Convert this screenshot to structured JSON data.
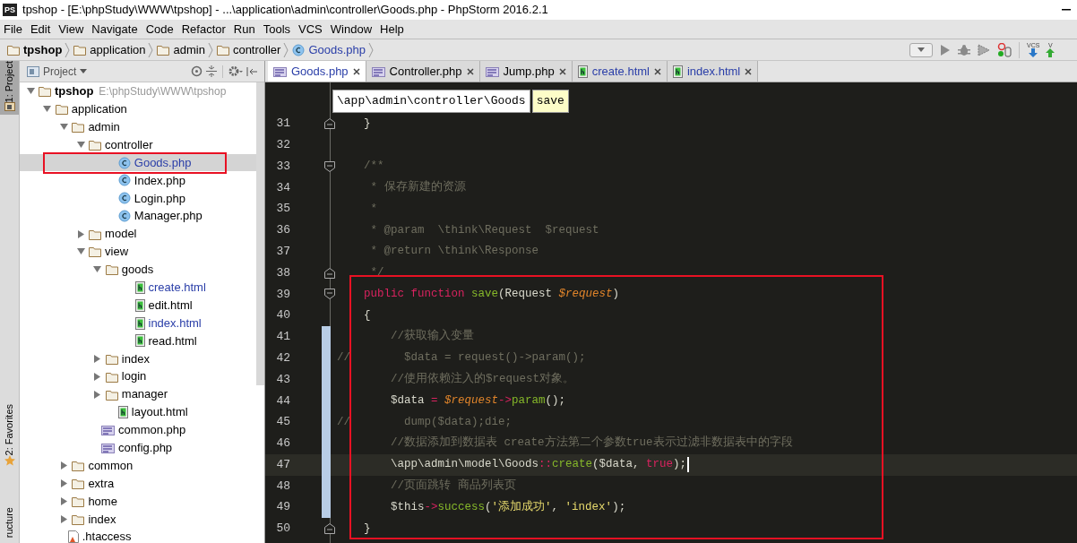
{
  "window": {
    "title": "tpshop - [E:\\phpStudy\\WWW\\tpshop] - ...\\application\\admin\\controller\\Goods.php - PhpStorm 2016.2.1",
    "app_badge": "PS"
  },
  "menu": [
    "File",
    "Edit",
    "View",
    "Navigate",
    "Code",
    "Refactor",
    "Run",
    "Tools",
    "VCS",
    "Window",
    "Help"
  ],
  "breadcrumb": [
    {
      "label": "tpshop",
      "kind": "project"
    },
    {
      "label": "application",
      "kind": "folder"
    },
    {
      "label": "admin",
      "kind": "folder"
    },
    {
      "label": "controller",
      "kind": "folder"
    },
    {
      "label": "Goods.php",
      "kind": "class"
    }
  ],
  "toolbar": {
    "vcs_buttons": [
      "VCS",
      "V"
    ]
  },
  "side_tabs": [
    {
      "label": "1: Project",
      "selected": true,
      "kind": "project"
    },
    {
      "label": "2: Favorites",
      "selected": false,
      "kind": "favorites"
    },
    {
      "label": "ructure",
      "selected": false,
      "kind": "structure"
    }
  ],
  "project_panel": {
    "title": "Project",
    "tree": [
      {
        "label": "tpshop",
        "path": "E:\\phpStudy\\WWW\\tpshop",
        "kind": "folder",
        "expanded": true,
        "selected": false,
        "modified": false,
        "children": [
          {
            "label": "application",
            "kind": "folder",
            "expanded": true,
            "selected": false,
            "modified": false,
            "children": [
              {
                "label": "admin",
                "kind": "folder",
                "expanded": true,
                "selected": false,
                "modified": false,
                "children": [
                  {
                    "label": "controller",
                    "kind": "folder",
                    "expanded": true,
                    "selected": false,
                    "modified": false,
                    "children": [
                      {
                        "label": "Goods.php",
                        "kind": "class",
                        "selected": true,
                        "modified": true
                      },
                      {
                        "label": "Index.php",
                        "kind": "class",
                        "selected": false,
                        "modified": false
                      },
                      {
                        "label": "Login.php",
                        "kind": "class",
                        "selected": false,
                        "modified": false
                      },
                      {
                        "label": "Manager.php",
                        "kind": "class",
                        "selected": false,
                        "modified": false
                      }
                    ]
                  },
                  {
                    "label": "model",
                    "kind": "folder",
                    "expanded": false,
                    "selected": false,
                    "modified": false
                  },
                  {
                    "label": "view",
                    "kind": "folder",
                    "expanded": true,
                    "selected": false,
                    "modified": false,
                    "children": [
                      {
                        "label": "goods",
                        "kind": "folder",
                        "expanded": true,
                        "selected": false,
                        "modified": false,
                        "children": [
                          {
                            "label": "create.html",
                            "kind": "html",
                            "selected": false,
                            "modified": true
                          },
                          {
                            "label": "edit.html",
                            "kind": "html",
                            "selected": false,
                            "modified": false
                          },
                          {
                            "label": "index.html",
                            "kind": "html",
                            "selected": false,
                            "modified": true
                          },
                          {
                            "label": "read.html",
                            "kind": "html",
                            "selected": false,
                            "modified": false
                          }
                        ]
                      },
                      {
                        "label": "index",
                        "kind": "folder",
                        "expanded": false,
                        "selected": false,
                        "modified": false
                      },
                      {
                        "label": "login",
                        "kind": "folder",
                        "expanded": false,
                        "selected": false,
                        "modified": false
                      },
                      {
                        "label": "manager",
                        "kind": "folder",
                        "expanded": false,
                        "selected": false,
                        "modified": false
                      },
                      {
                        "label": "layout.html",
                        "kind": "html",
                        "selected": false,
                        "modified": false
                      }
                    ]
                  },
                  {
                    "label": "common.php",
                    "kind": "php",
                    "selected": false,
                    "modified": false
                  },
                  {
                    "label": "config.php",
                    "kind": "php",
                    "selected": false,
                    "modified": false
                  }
                ]
              },
              {
                "label": "common",
                "kind": "folder",
                "expanded": false,
                "selected": false,
                "modified": false
              },
              {
                "label": "extra",
                "kind": "folder",
                "expanded": false,
                "selected": false,
                "modified": false
              },
              {
                "label": "home",
                "kind": "folder",
                "expanded": false,
                "selected": false,
                "modified": false
              },
              {
                "label": "index",
                "kind": "folder",
                "expanded": false,
                "selected": false,
                "modified": false
              }
            ]
          },
          {
            "label": ".htaccess",
            "kind": "htaccess",
            "selected": false,
            "modified": false
          }
        ]
      }
    ]
  },
  "editor_tabs": [
    {
      "label": "Goods.php",
      "kind": "php",
      "selected": true,
      "modified": true
    },
    {
      "label": "Controller.php",
      "kind": "php",
      "selected": false,
      "modified": false
    },
    {
      "label": "Jump.php",
      "kind": "php",
      "selected": false,
      "modified": false
    },
    {
      "label": "create.html",
      "kind": "html",
      "selected": false,
      "modified": true
    },
    {
      "label": "index.html",
      "kind": "html",
      "selected": false,
      "modified": true
    }
  ],
  "editor": {
    "breadcrumb_popup": [
      "\\app\\admin\\controller\\Goods",
      "save"
    ],
    "lines": [
      {
        "number": "31",
        "fold_end": true,
        "changed": false,
        "current": false,
        "tokens": [
          {
            "kind": "plain",
            "text": "    }"
          }
        ]
      },
      {
        "number": "32",
        "changed": false,
        "current": false
      },
      {
        "number": "33",
        "fold_start": true,
        "changed": false,
        "current": false,
        "tokens": [
          {
            "kind": "comment",
            "text": "    /**"
          }
        ]
      },
      {
        "number": "34",
        "changed": false,
        "current": false,
        "tokens": [
          {
            "kind": "comment",
            "text": "     * 保存新建的资源"
          }
        ]
      },
      {
        "number": "35",
        "changed": false,
        "current": false,
        "tokens": [
          {
            "kind": "comment",
            "text": "     *"
          }
        ]
      },
      {
        "number": "36",
        "changed": false,
        "current": false,
        "tokens": [
          {
            "kind": "comment",
            "text": "     * @param  \\think\\Request  $request"
          }
        ]
      },
      {
        "number": "37",
        "changed": false,
        "current": false,
        "tokens": [
          {
            "kind": "comment",
            "text": "     * @return \\think\\Response"
          }
        ]
      },
      {
        "number": "38",
        "fold_end": true,
        "changed": false,
        "current": false,
        "tokens": [
          {
            "kind": "comment",
            "text": "     */"
          }
        ]
      },
      {
        "number": "39",
        "fold_start": true,
        "changed": false,
        "current": false,
        "tokens": [
          {
            "kind": "keyword",
            "text": "    public function "
          },
          {
            "kind": "function",
            "text": "save"
          },
          {
            "kind": "plain",
            "text": "(Request "
          },
          {
            "kind": "variable",
            "text": "$request"
          },
          {
            "kind": "plain",
            "text": ")"
          }
        ]
      },
      {
        "number": "40",
        "changed": false,
        "current": false,
        "tokens": [
          {
            "kind": "plain",
            "text": "    {"
          }
        ]
      },
      {
        "number": "41",
        "changed": true,
        "current": false,
        "tokens": [
          {
            "kind": "comment",
            "text": "        //获取输入变量"
          }
        ]
      },
      {
        "number": "42",
        "changed": true,
        "current": false,
        "tokens": [
          {
            "kind": "comment",
            "text": "//        $data = request()->param();"
          }
        ]
      },
      {
        "number": "43",
        "changed": true,
        "current": false,
        "tokens": [
          {
            "kind": "comment",
            "text": "        //使用依赖注入的$request对象。"
          }
        ]
      },
      {
        "number": "44",
        "changed": true,
        "current": false,
        "tokens": [
          {
            "kind": "plain",
            "text": "        $data "
          },
          {
            "kind": "operator",
            "text": "= "
          },
          {
            "kind": "variable",
            "text": "$request"
          },
          {
            "kind": "operator",
            "text": "->"
          },
          {
            "kind": "function",
            "text": "param"
          },
          {
            "kind": "plain",
            "text": "();"
          }
        ]
      },
      {
        "number": "45",
        "changed": true,
        "current": false,
        "tokens": [
          {
            "kind": "comment",
            "text": "//        dump($data);die;"
          }
        ]
      },
      {
        "number": "46",
        "changed": true,
        "current": false,
        "tokens": [
          {
            "kind": "comment",
            "text": "        //数据添加到数据表 create方法第二个参数true表示过滤非数据表中的字段"
          }
        ]
      },
      {
        "number": "47",
        "changed": true,
        "current": true,
        "tokens": [
          {
            "kind": "plain",
            "text": "        \\app\\admin\\model\\Goods"
          },
          {
            "kind": "operator",
            "text": "::"
          },
          {
            "kind": "function",
            "text": "create"
          },
          {
            "kind": "plain",
            "text": "($data, "
          },
          {
            "kind": "keyword",
            "text": "true"
          },
          {
            "kind": "plain",
            "text": ");"
          }
        ]
      },
      {
        "number": "48",
        "changed": true,
        "current": false,
        "tokens": [
          {
            "kind": "comment",
            "text": "        //页面跳转 商品列表页"
          }
        ]
      },
      {
        "number": "49",
        "changed": true,
        "current": false,
        "tokens": [
          {
            "kind": "plain",
            "text": "        $this"
          },
          {
            "kind": "operator",
            "text": "->"
          },
          {
            "kind": "function",
            "text": "success"
          },
          {
            "kind": "plain",
            "text": "("
          },
          {
            "kind": "string",
            "text": "'添加成功'"
          },
          {
            "kind": "plain",
            "text": ", "
          },
          {
            "kind": "string",
            "text": "'index'"
          },
          {
            "kind": "plain",
            "text": ");"
          }
        ]
      },
      {
        "number": "50",
        "fold_end": true,
        "changed": false,
        "current": false,
        "tokens": [
          {
            "kind": "plain",
            "text": "    }"
          }
        ]
      }
    ]
  }
}
